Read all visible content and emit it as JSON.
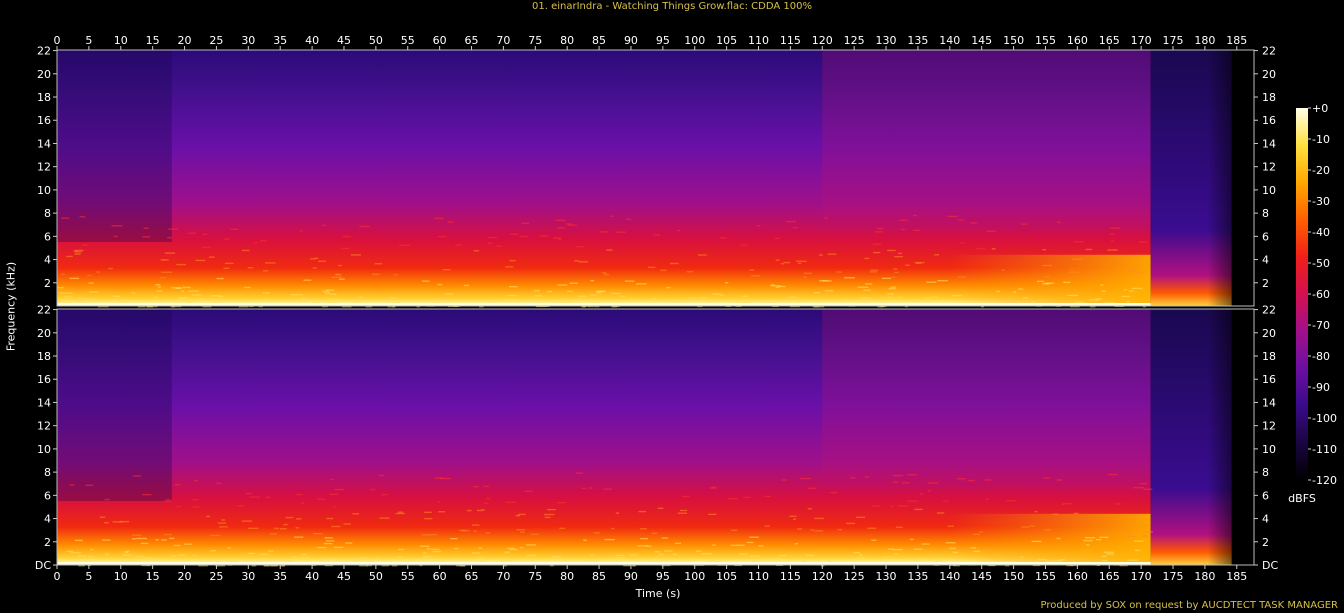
{
  "title": "01. einarIndra - Watching Things Grow.flac: CDDA 100%",
  "footer": "Produced by SOX on request by AUCDTECT TASK MANAGER",
  "chart_data": {
    "type": "heatmap",
    "xlabel": "Time (s)",
    "ylabel": "Frequency (kHz)",
    "xlim": [
      0,
      187.7
    ],
    "ylim": [
      0,
      22.05
    ],
    "x_ticks": [
      "0",
      "5",
      "10",
      "15",
      "20",
      "25",
      "30",
      "35",
      "40",
      "45",
      "50",
      "55",
      "60",
      "65",
      "70",
      "75",
      "80",
      "85",
      "90",
      "95",
      "100",
      "105",
      "110",
      "115",
      "120",
      "125",
      "130",
      "135",
      "140",
      "145",
      "150",
      "155",
      "160",
      "165",
      "170",
      "175",
      "180",
      "185"
    ],
    "y_ticks_top": [
      "2",
      "4",
      "6",
      "8",
      "10",
      "12",
      "14",
      "16",
      "18",
      "20",
      "22"
    ],
    "y_ticks_bottom": [
      "DC",
      "2",
      "4",
      "6",
      "8",
      "10",
      "12",
      "14",
      "16",
      "18",
      "20",
      "22"
    ],
    "channels": 2,
    "audio_end_s": 171.5,
    "fade_end_s": 182,
    "quiet_intro_end_s": 18,
    "colorbar": {
      "label": "dBFS",
      "ticks": [
        "+0",
        "-10",
        "-20",
        "-30",
        "-40",
        "-50",
        "-60",
        "-70",
        "-80",
        "-90",
        "-100",
        "-110",
        "-120"
      ],
      "range": [
        -120,
        0
      ],
      "colors": [
        "#000000",
        "#1a0540",
        "#3a0a8a",
        "#6b0fa0",
        "#a0108a",
        "#d41050",
        "#f02018",
        "#ff6000",
        "#ffa800",
        "#ffe040",
        "#ffffe8"
      ]
    }
  }
}
